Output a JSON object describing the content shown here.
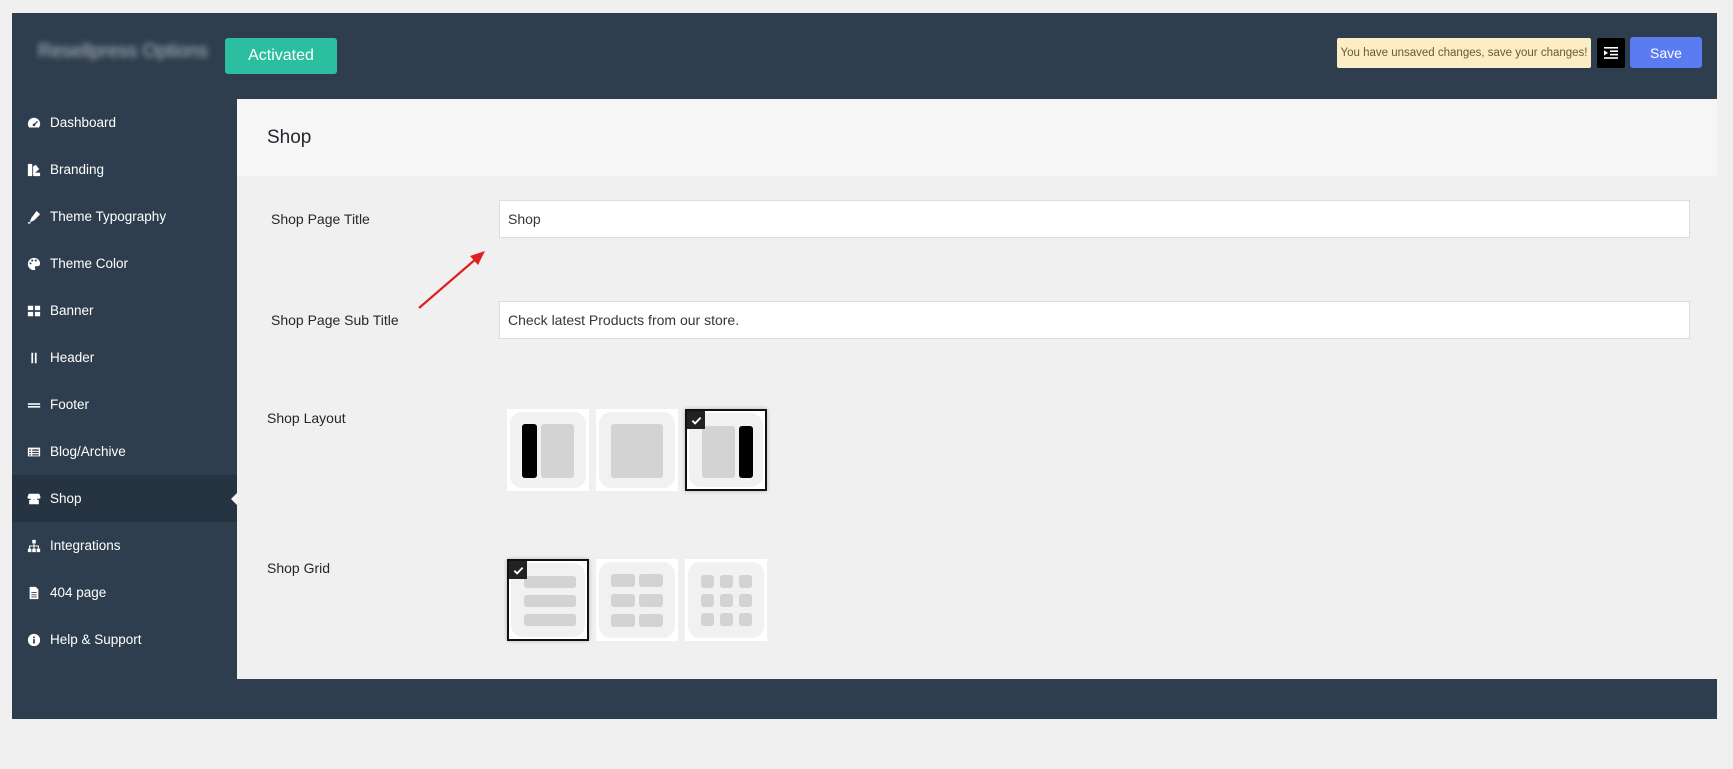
{
  "header": {
    "app_title": "Resellpress Options",
    "status_badge": "Activated",
    "unsaved_notice": "You have unsaved changes, save your changes!",
    "save_label": "Save"
  },
  "sidebar": {
    "items": [
      {
        "label": "Dashboard",
        "icon": "dashboard-icon"
      },
      {
        "label": "Branding",
        "icon": "branding-icon"
      },
      {
        "label": "Theme Typography",
        "icon": "pen-icon"
      },
      {
        "label": "Theme Color",
        "icon": "palette-icon"
      },
      {
        "label": "Banner",
        "icon": "grid-icon"
      },
      {
        "label": "Header",
        "icon": "header-icon"
      },
      {
        "label": "Footer",
        "icon": "footer-icon"
      },
      {
        "label": "Blog/Archive",
        "icon": "list-icon"
      },
      {
        "label": "Shop",
        "icon": "store-icon",
        "active": true
      },
      {
        "label": "Integrations",
        "icon": "sitemap-icon"
      },
      {
        "label": "404 page",
        "icon": "file-icon"
      },
      {
        "label": "Help & Support",
        "icon": "info-icon"
      }
    ]
  },
  "main": {
    "title": "Shop",
    "fields": {
      "page_title": {
        "label": "Shop Page Title",
        "value": "Shop"
      },
      "page_subtitle": {
        "label": "Shop Page Sub Title",
        "value": "Check latest Products from our store."
      },
      "layout": {
        "label": "Shop Layout",
        "selected": "right-sidebar",
        "options": [
          "left-sidebar",
          "no-sidebar",
          "right-sidebar"
        ]
      },
      "grid": {
        "label": "Shop Grid",
        "selected": "1-column",
        "options": [
          "1-column",
          "2-column",
          "3-column"
        ]
      }
    }
  },
  "colors": {
    "frame": "#2f3e4e",
    "activated": "#2bbf9f",
    "save": "#5b7cf0",
    "notice": "#fbeec7",
    "annotation_arrow": "#e02020"
  }
}
